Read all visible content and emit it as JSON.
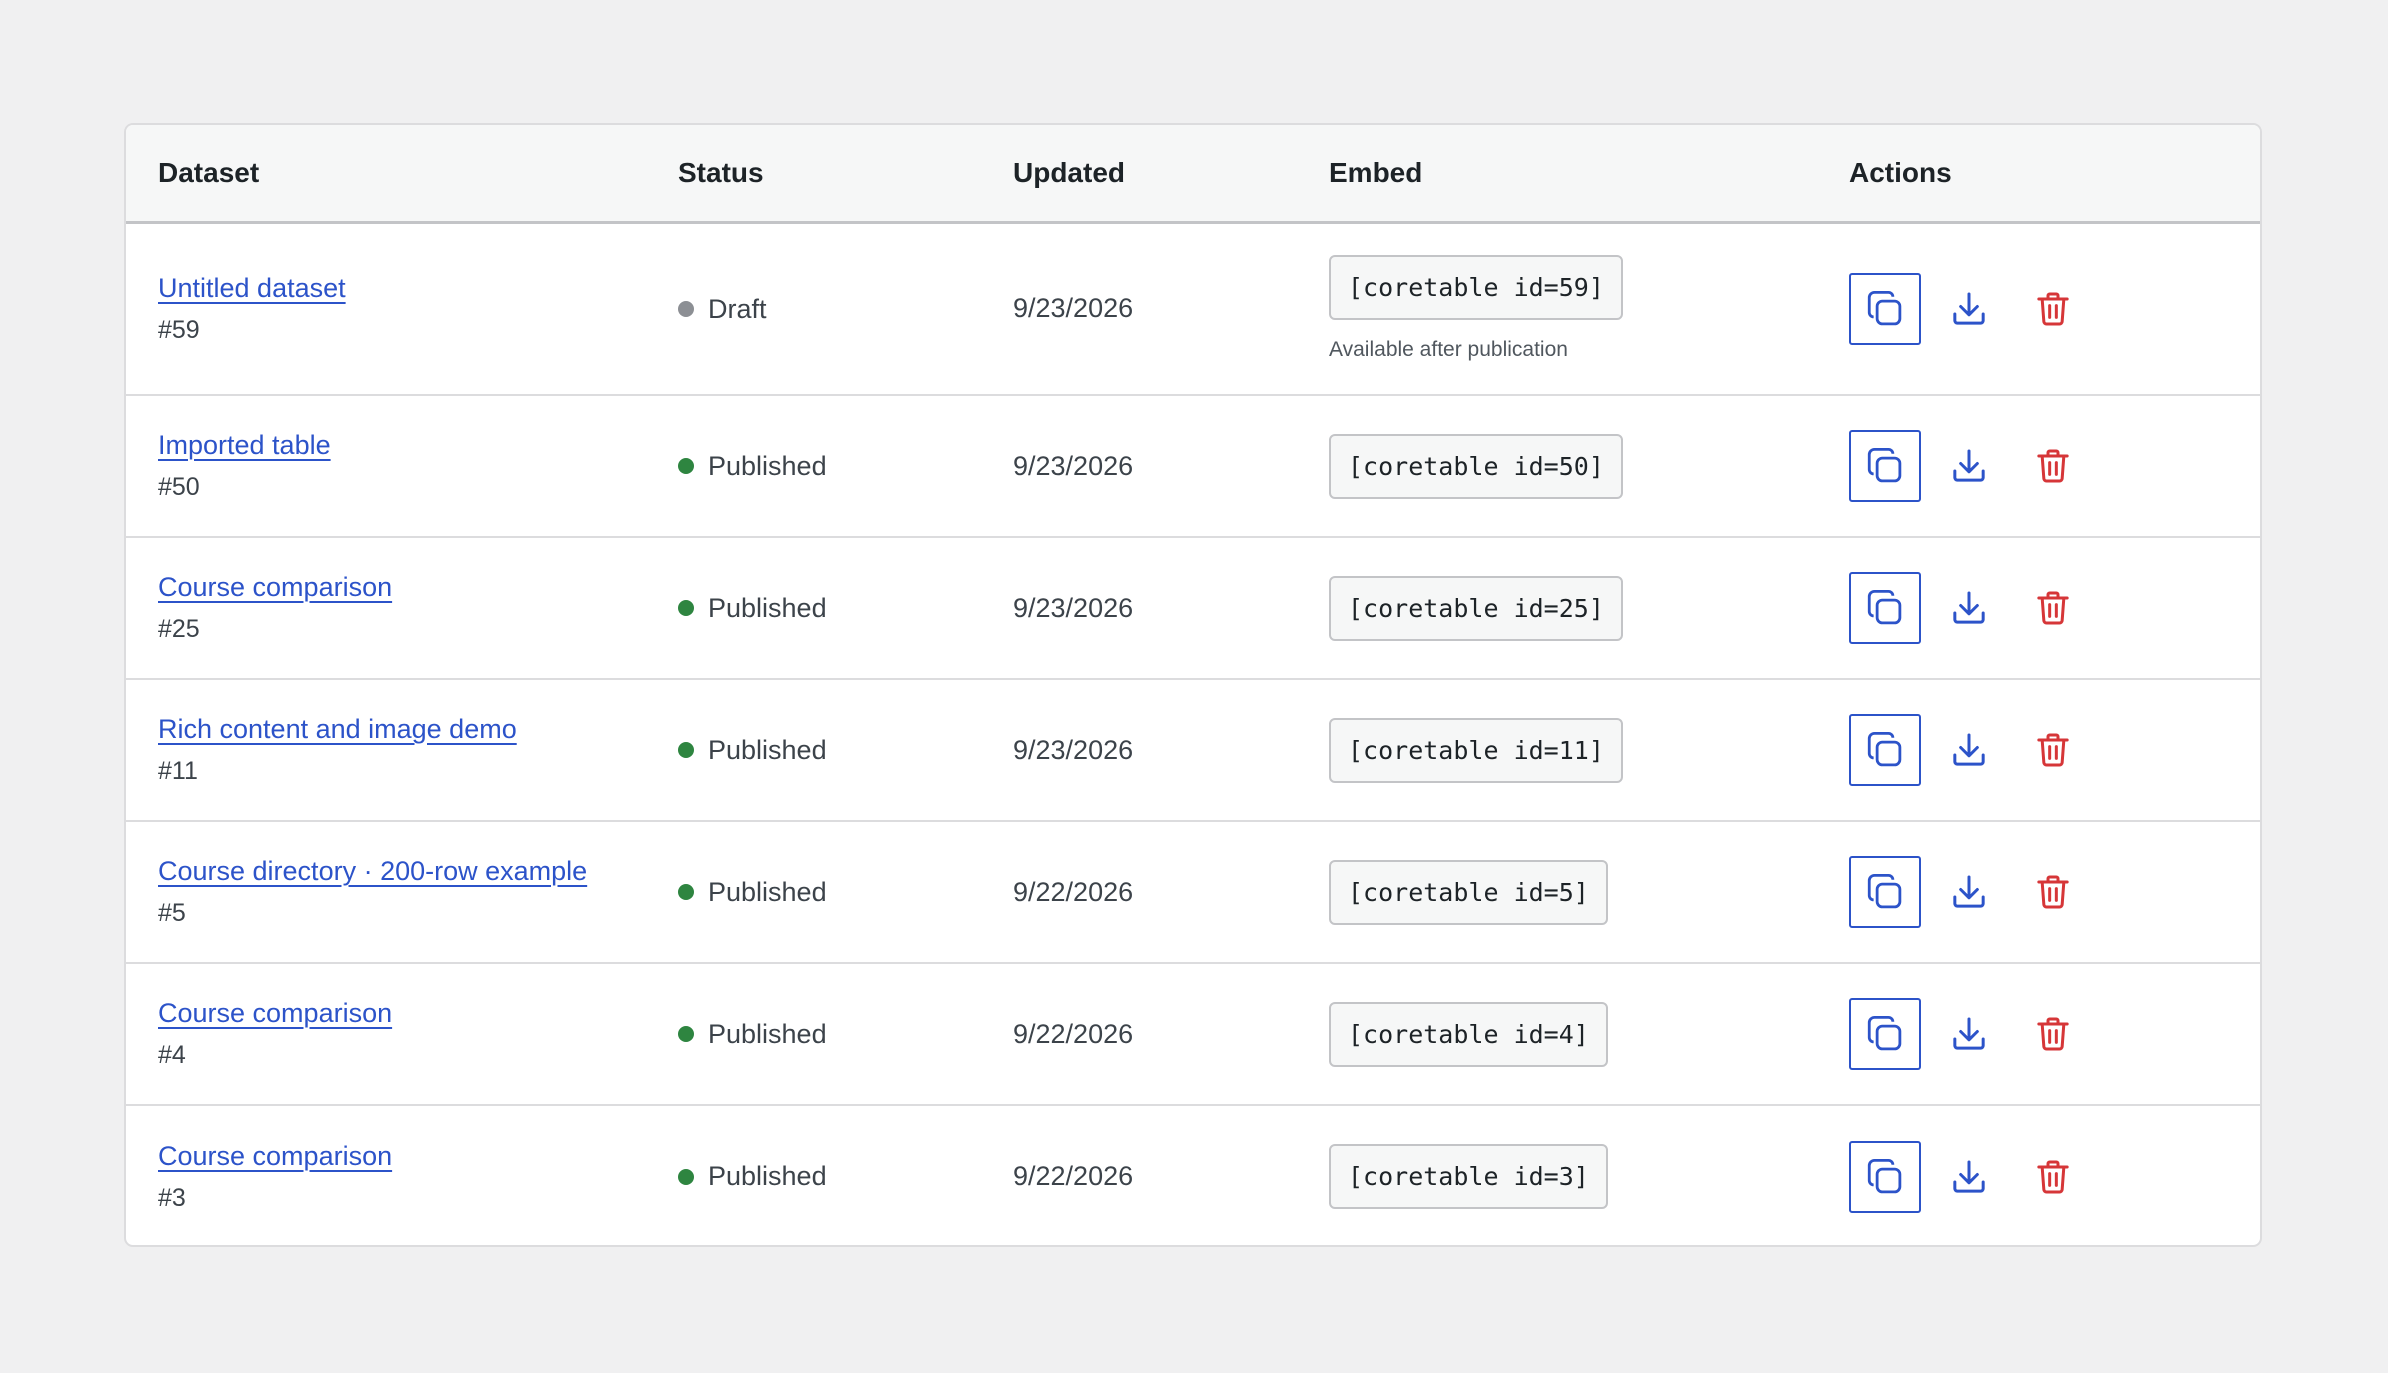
{
  "table": {
    "headers": {
      "dataset": "Dataset",
      "status": "Status",
      "updated": "Updated",
      "embed": "Embed",
      "actions": "Actions"
    },
    "rows": [
      {
        "name": "Untitled dataset",
        "id": "#59",
        "status": "Draft",
        "status_color": "#8c8f94",
        "updated": "9/23/2026",
        "shortcode": "[coretable id=59]",
        "note": "Available after publication"
      },
      {
        "name": "Imported table",
        "id": "#50",
        "status": "Published",
        "status_color": "#2e8540",
        "updated": "9/23/2026",
        "shortcode": "[coretable id=50]",
        "note": ""
      },
      {
        "name": "Course comparison",
        "id": "#25",
        "status": "Published",
        "status_color": "#2e8540",
        "updated": "9/23/2026",
        "shortcode": "[coretable id=25]",
        "note": ""
      },
      {
        "name": "Rich content and image demo",
        "id": "#11",
        "status": "Published",
        "status_color": "#2e8540",
        "updated": "9/23/2026",
        "shortcode": "[coretable id=11]",
        "note": ""
      },
      {
        "name": "Course directory · 200-row example",
        "id": "#5",
        "status": "Published",
        "status_color": "#2e8540",
        "updated": "9/22/2026",
        "shortcode": "[coretable id=5]",
        "note": ""
      },
      {
        "name": "Course comparison",
        "id": "#4",
        "status": "Published",
        "status_color": "#2e8540",
        "updated": "9/22/2026",
        "shortcode": "[coretable id=4]",
        "note": ""
      },
      {
        "name": "Course comparison",
        "id": "#3",
        "status": "Published",
        "status_color": "#2e8540",
        "updated": "9/22/2026",
        "shortcode": "[coretable id=3]",
        "note": ""
      }
    ]
  },
  "actions": {
    "copy_icon": "copy-icon",
    "download_icon": "download-icon",
    "delete_icon": "trash-icon"
  },
  "colors": {
    "link": "#2c53c9",
    "action_blue": "#2c53c9",
    "delete_red": "#d63638",
    "published": "#2e8540",
    "draft": "#8c8f94"
  }
}
